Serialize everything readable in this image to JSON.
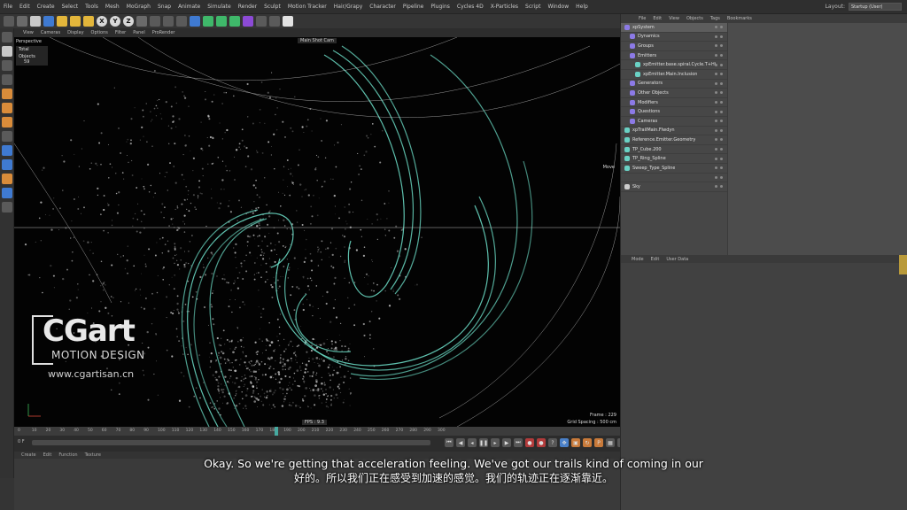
{
  "menubar": {
    "items": [
      "File",
      "Edit",
      "Create",
      "Select",
      "Tools",
      "Mesh",
      "MoGraph",
      "Snap",
      "Animate",
      "Simulate",
      "Render",
      "Sculpt",
      "Motion Tracker",
      "Hair/Grapy",
      "Character",
      "Pipeline",
      "Plugins",
      "Cycles 4D",
      "X-Particles",
      "Script",
      "Window",
      "Help"
    ],
    "layout_label": "Layout:",
    "layout_value": "Startup (User)"
  },
  "toolbar": {
    "axis_x": "X",
    "axis_y": "Y",
    "axis_z": "Z"
  },
  "viewport": {
    "menu": [
      "View",
      "Cameras",
      "Display",
      "Options",
      "Filter",
      "Panel",
      "ProRender"
    ],
    "label": "Perspective",
    "hud_total": "Total",
    "hud_objects_label": "Objects",
    "hud_objects_value": "59",
    "camera": "Main Shot Cam",
    "move_label": "Move",
    "frame": "Frame : 229",
    "grid_spacing": "Grid Spacing : 500 cm",
    "fps": "FPS : 9.3"
  },
  "watermark": {
    "brand": "CGart",
    "sub": "MOTION DESIGN",
    "url": "www.cgartisan.cn"
  },
  "timeline": {
    "ticks": [
      "0",
      "10",
      "20",
      "30",
      "40",
      "50",
      "60",
      "70",
      "80",
      "90",
      "100",
      "110",
      "120",
      "130",
      "140",
      "150",
      "160",
      "170",
      "180",
      "190",
      "200",
      "210",
      "220",
      "230",
      "240",
      "250",
      "260",
      "270",
      "280",
      "290",
      "300"
    ],
    "start_frame": "0 F"
  },
  "attr_tabs": [
    "Create",
    "Edit",
    "Function",
    "Texture"
  ],
  "object_manager": {
    "menu": [
      "File",
      "Edit",
      "View",
      "Objects",
      "Tags",
      "Bookmarks"
    ],
    "rows": [
      {
        "name": "xpSystem",
        "indent": 0,
        "color": "#8c7ae6",
        "hl": true
      },
      {
        "name": "Dynamics",
        "indent": 1,
        "color": "#8c7ae6",
        "hl": false
      },
      {
        "name": "Groups",
        "indent": 1,
        "color": "#8c7ae6",
        "hl": false
      },
      {
        "name": "Emitters",
        "indent": 1,
        "color": "#8c7ae6",
        "hl": false
      },
      {
        "name": "xpEmitter.base.spiral.Cycle.T+Hi",
        "indent": 2,
        "color": "#6ad1c4",
        "hl": false
      },
      {
        "name": "xpEmitter.Main.Inclusion",
        "indent": 2,
        "color": "#6ad1c4",
        "hl": false
      },
      {
        "name": "Generators",
        "indent": 1,
        "color": "#8c7ae6",
        "hl": false
      },
      {
        "name": "Other Objects",
        "indent": 1,
        "color": "#8c7ae6",
        "hl": false
      },
      {
        "name": "Modifiers",
        "indent": 1,
        "color": "#8c7ae6",
        "hl": false
      },
      {
        "name": "Questions",
        "indent": 1,
        "color": "#8c7ae6",
        "hl": false
      },
      {
        "name": "Cameras",
        "indent": 1,
        "color": "#8c7ae6",
        "hl": false
      },
      {
        "name": "xpTrailMain.Flwdyn",
        "indent": 0,
        "color": "#6ad1c4",
        "hl": false
      },
      {
        "name": "Reference.Emitter.Geometry",
        "indent": 0,
        "color": "#6ad1c4",
        "hl": false
      },
      {
        "name": "TP_Cube.200",
        "indent": 0,
        "color": "#6ad1c4",
        "hl": false
      },
      {
        "name": "TP_Ring_Spline",
        "indent": 0,
        "color": "#6ad1c4",
        "hl": false
      },
      {
        "name": "Sweep_Type_Spline",
        "indent": 0,
        "color": "#6ad1c4",
        "hl": false
      },
      {
        "name": "",
        "indent": 0,
        "color": "#474747",
        "hl": false
      },
      {
        "name": "Sky",
        "indent": 0,
        "color": "#cccccc",
        "hl": false
      }
    ]
  },
  "attribute_manager": {
    "menu": [
      "Mode",
      "Edit",
      "User Data"
    ]
  },
  "subtitle": {
    "en": "Okay. So we're getting that acceleration feeling. We've got our trails kind of coming in our",
    "zh": "好的。所以我们正在感受到加速的感觉。我们的轨迹正在逐渐靠近。"
  },
  "colors": {
    "trail": "#6fe3cc",
    "particles": "#d8d8d8",
    "playhead": "#46a9a0"
  }
}
